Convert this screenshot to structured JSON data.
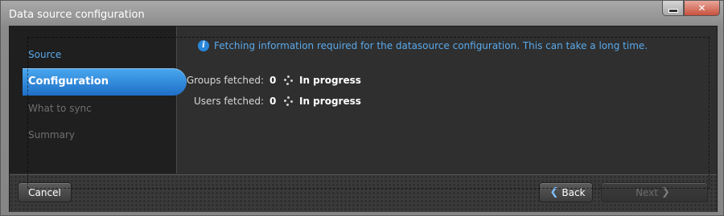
{
  "window": {
    "title": "Data source configuration"
  },
  "sidebar": {
    "items": [
      {
        "label": "Source"
      },
      {
        "label": "Configuration"
      },
      {
        "label": "What to sync"
      },
      {
        "label": "Summary"
      }
    ]
  },
  "main": {
    "info_text": "Fetching information required for the datasource configuration. This can take a long time.",
    "rows": [
      {
        "label": "Groups fetched:",
        "count": "0",
        "status": "In progress"
      },
      {
        "label": "Users fetched:",
        "count": "0",
        "status": "In progress"
      }
    ]
  },
  "footer": {
    "cancel_label": "Cancel",
    "back_label": "Back",
    "next_label": "Next"
  },
  "colors": {
    "accent": "#2a86d9",
    "selected_nav": "#1e6fc8",
    "link_text": "#5aa9ea"
  },
  "icons": {
    "info": "info-icon",
    "spinner": "spinner-icon",
    "back": "chevron-left-icon",
    "next": "chevron-right-icon",
    "close": "close-icon",
    "minimize": "minimize-icon"
  }
}
